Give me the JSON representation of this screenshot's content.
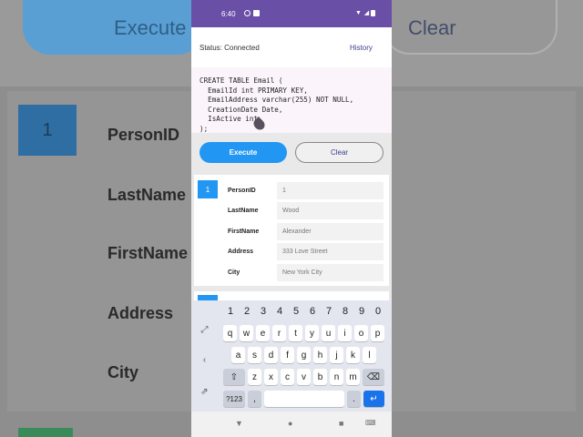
{
  "background": {
    "execute_label": "Execute",
    "clear_label": "Clear",
    "record_number": "1",
    "fields": [
      "PersonID",
      "LastName",
      "FirstName",
      "Address",
      "City"
    ]
  },
  "statusbar": {
    "time": "6:40"
  },
  "appbar": {
    "status": "Status: Connected",
    "history_label": "History"
  },
  "editor": {
    "sql": "CREATE TABLE Email (\n  EmailId int PRIMARY KEY,\n  EmailAddress varchar(255) NOT NULL,\n  CreationDate Date,\n  IsActive int\n);"
  },
  "buttons": {
    "execute": "Execute",
    "clear": "Clear"
  },
  "record": {
    "number": "1",
    "rows": [
      {
        "label": "PersonID",
        "value": "1"
      },
      {
        "label": "LastName",
        "value": "Wood"
      },
      {
        "label": "FirstName",
        "value": "Alexander"
      },
      {
        "label": "Address",
        "value": "333 Love Street"
      },
      {
        "label": "City",
        "value": "New York City"
      }
    ]
  },
  "keyboard": {
    "numbers": [
      "1",
      "2",
      "3",
      "4",
      "5",
      "6",
      "7",
      "8",
      "9",
      "0"
    ],
    "row1": [
      "q",
      "w",
      "e",
      "r",
      "t",
      "y",
      "u",
      "i",
      "o",
      "p"
    ],
    "row2": [
      "a",
      "s",
      "d",
      "f",
      "g",
      "h",
      "j",
      "k",
      "l"
    ],
    "row3": [
      "z",
      "x",
      "c",
      "v",
      "b",
      "n",
      "m"
    ],
    "sym_label": "?123",
    "comma": ",",
    "period": "."
  },
  "colors": {
    "accent": "#2196f3",
    "statusbar": "#6a4fa6",
    "link": "#3d3d8f"
  }
}
